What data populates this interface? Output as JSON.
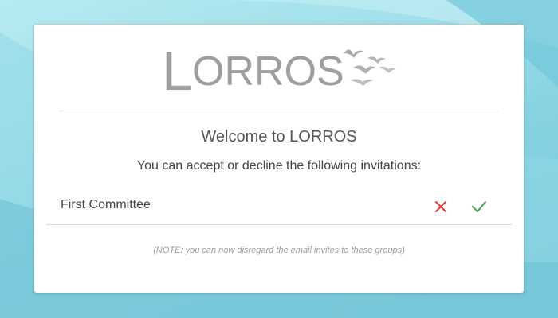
{
  "brand": {
    "logo_text": "LORROS"
  },
  "welcome": {
    "title": "Welcome to LORROS",
    "subtitle": "You can accept or decline the following invitations:"
  },
  "invitations": [
    {
      "name": "First Committee",
      "decline_icon": "close-icon",
      "accept_icon": "checkmark-icon"
    }
  ],
  "note": "(NOTE: you can now disregard the email invites to these groups)",
  "colors": {
    "decline": "#e53935",
    "accept": "#43a047",
    "logo": "#9e9e9e"
  }
}
